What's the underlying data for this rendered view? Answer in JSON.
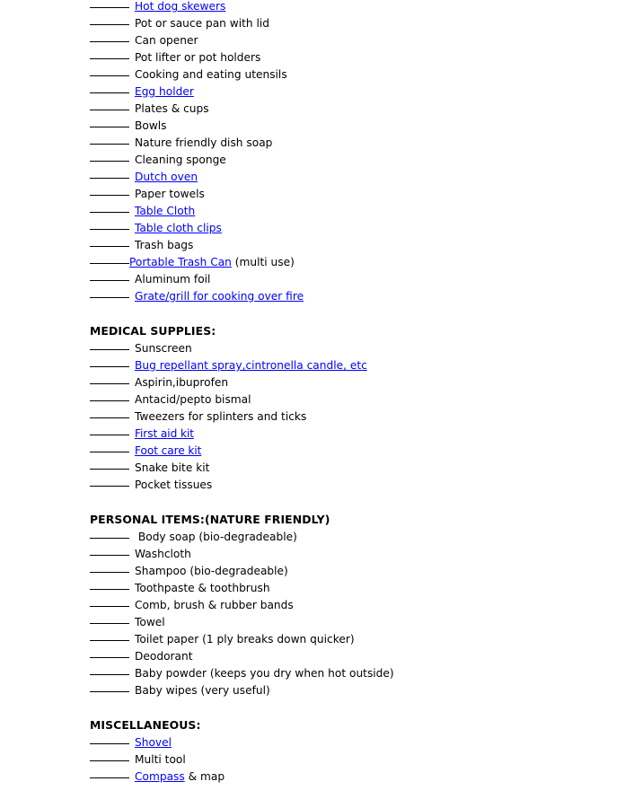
{
  "document": {
    "title": "Camping Checklist",
    "link_color": "#0000FF",
    "text_color": "#000000",
    "background_color": "#FFFFFF",
    "blank_rule": "______"
  },
  "sections": [
    {
      "heading": null,
      "items": [
        {
          "label": "Hot dog skewers",
          "link": true,
          "suffix": "",
          "clipped_top": true
        },
        {
          "label": "Pot or sauce pan with lid",
          "link": false,
          "suffix": ""
        },
        {
          "label": "Can opener",
          "link": false,
          "suffix": ""
        },
        {
          "label": "Pot lifter or pot holders",
          "link": false,
          "suffix": ""
        },
        {
          "label": "Cooking and eating utensils",
          "link": false,
          "suffix": ""
        },
        {
          "label": "Egg holder",
          "link": true,
          "suffix": ""
        },
        {
          "label": "Plates & cups",
          "link": false,
          "suffix": ""
        },
        {
          "label": "Bowls",
          "link": false,
          "suffix": ""
        },
        {
          "label": "Nature friendly dish soap",
          "link": false,
          "suffix": ""
        },
        {
          "label": "Cleaning sponge",
          "link": false,
          "suffix": ""
        },
        {
          "label": "Dutch oven",
          "link": true,
          "suffix": ""
        },
        {
          "label": "Paper towels",
          "link": false,
          "suffix": ""
        },
        {
          "label": "Table Cloth",
          "link": true,
          "suffix": ""
        },
        {
          "label": "Table cloth clips",
          "link": true,
          "suffix": ""
        },
        {
          "label": "Trash bags",
          "link": false,
          "suffix": ""
        },
        {
          "label": "Portable Trash Can",
          "link": true,
          "suffix": " (multi use)",
          "tight": true
        },
        {
          "label": "Aluminum foil",
          "link": false,
          "suffix": ""
        },
        {
          "label": "Grate/grill for cooking over fire",
          "link": true,
          "suffix": ""
        }
      ]
    },
    {
      "heading": "MEDICAL SUPPLIES:",
      "items": [
        {
          "label": "Sunscreen",
          "link": false,
          "suffix": ""
        },
        {
          "label": "Bug repellant spray,cintronella candle, etc",
          "link": true,
          "suffix": ""
        },
        {
          "label": "Aspirin,ibuprofen",
          "link": false,
          "suffix": ""
        },
        {
          "label": "Antacid/pepto bismal",
          "link": false,
          "suffix": ""
        },
        {
          "label": "Tweezers for splinters and ticks",
          "link": false,
          "suffix": ""
        },
        {
          "label": "First aid kit",
          "link": true,
          "suffix": "",
          "altfont": true
        },
        {
          "label": "Foot care kit",
          "link": true,
          "suffix": "",
          "altfont": true
        },
        {
          "label": "Snake bite kit",
          "link": false,
          "suffix": ""
        },
        {
          "label": "Pocket tissues",
          "link": false,
          "suffix": ""
        }
      ]
    },
    {
      "heading": "PERSONAL ITEMS:(NATURE FRIENDLY)",
      "items": [
        {
          "label": " Body soap (bio-degradeable)",
          "link": false,
          "suffix": ""
        },
        {
          "label": "Washcloth",
          "link": false,
          "suffix": ""
        },
        {
          "label": "Shampoo (bio-degradeable)",
          "link": false,
          "suffix": ""
        },
        {
          "label": "Toothpaste & toothbrush",
          "link": false,
          "suffix": ""
        },
        {
          "label": "Comb, brush & rubber bands",
          "link": false,
          "suffix": ""
        },
        {
          "label": "Towel",
          "link": false,
          "suffix": ""
        },
        {
          "label": "Toilet paper (1 ply breaks down quicker)",
          "link": false,
          "suffix": ""
        },
        {
          "label": "Deodorant",
          "link": false,
          "suffix": ""
        },
        {
          "label": "Baby powder (keeps you dry when hot outside)",
          "link": false,
          "suffix": ""
        },
        {
          "label": "Baby wipes (very useful)",
          "link": false,
          "suffix": ""
        }
      ]
    },
    {
      "heading": "MISCELLANEOUS:",
      "items": [
        {
          "label": "Shovel",
          "link": true,
          "suffix": ""
        },
        {
          "label": "Multi tool",
          "link": false,
          "suffix": ""
        },
        {
          "label": "Compass",
          "link": true,
          "suffix": " & map"
        }
      ]
    }
  ]
}
